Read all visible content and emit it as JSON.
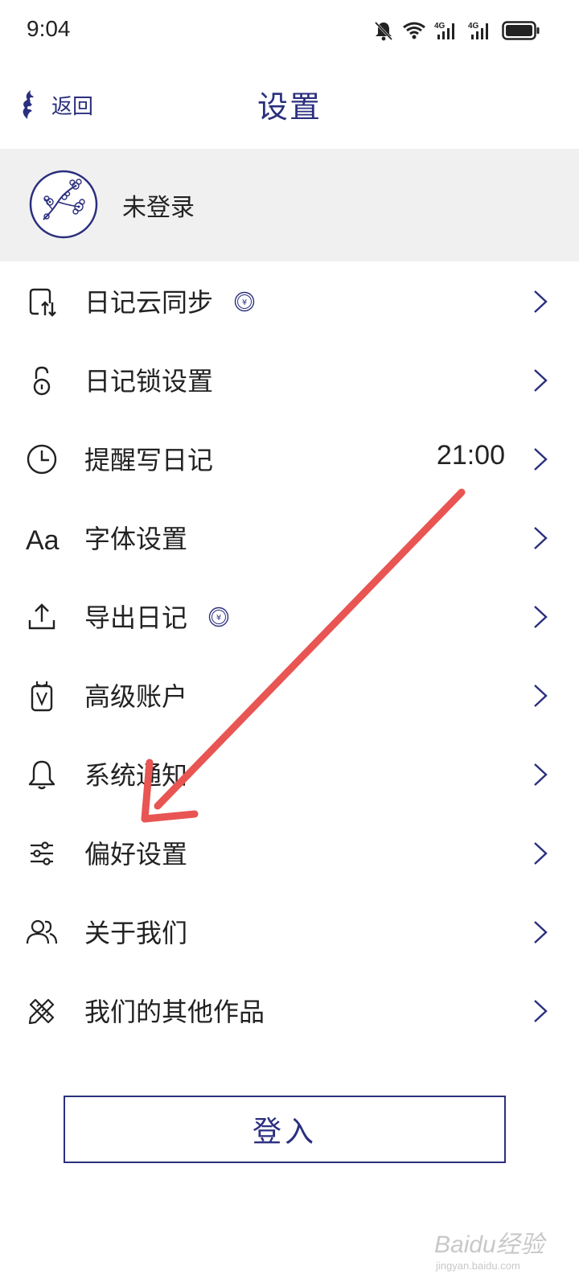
{
  "status_bar": {
    "time": "9:04",
    "icons": [
      "bell-muted-icon",
      "wifi-icon",
      "signal-4g-icon",
      "signal-4g-icon",
      "battery-icon"
    ],
    "network_label_1": "4G",
    "network_label_2": "4G"
  },
  "nav": {
    "back_label": "返回",
    "title": "设置"
  },
  "profile": {
    "name": "未登录"
  },
  "menu": {
    "items": [
      {
        "label": "日记云同步",
        "icon": "cloud-sync-icon",
        "badge": "coin-icon"
      },
      {
        "label": "日记锁设置",
        "icon": "lock-icon"
      },
      {
        "label": "提醒写日记",
        "icon": "clock-icon",
        "value": "21:00"
      },
      {
        "label": "字体设置",
        "icon": "font-icon",
        "icon_text": "Aa"
      },
      {
        "label": "导出日记",
        "icon": "export-icon",
        "badge": "coin-icon"
      },
      {
        "label": "高级账户",
        "icon": "premium-icon"
      },
      {
        "label": "系统通知",
        "icon": "bell-icon"
      },
      {
        "label": "偏好设置",
        "icon": "sliders-icon"
      },
      {
        "label": "关于我们",
        "icon": "users-icon"
      },
      {
        "label": "我们的其他作品",
        "icon": "pencil-ruler-icon"
      }
    ]
  },
  "login_button": {
    "label": "登入"
  },
  "watermark": {
    "text": "Baidu经验",
    "sub": "jingyan.baidu.com"
  },
  "colors": {
    "accent": "#2b2f7e",
    "profile_bg": "#f0f0f0",
    "annotation": "#e85552"
  }
}
